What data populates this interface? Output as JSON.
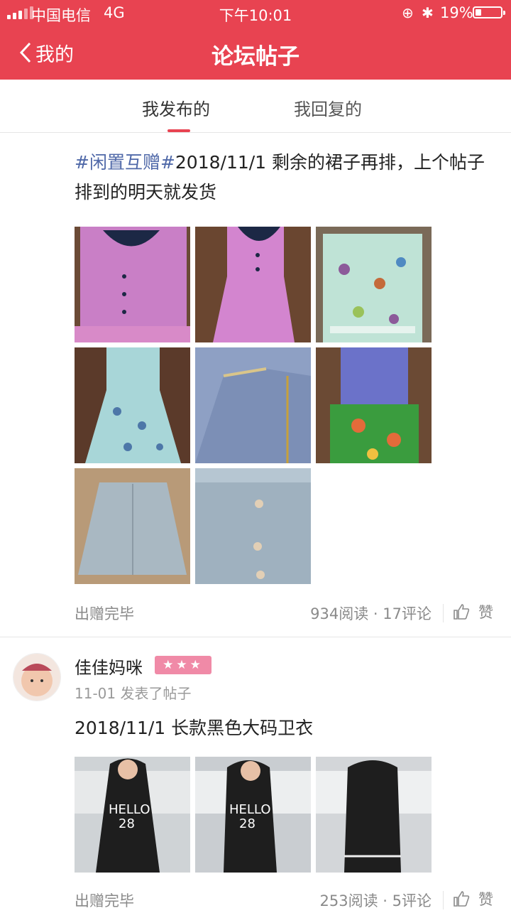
{
  "status_bar": {
    "carrier": "中国电信",
    "network": "4G",
    "time": "下午10:01",
    "battery": "19%"
  },
  "nav": {
    "back_label": "我的",
    "title": "论坛帖子"
  },
  "tabs": [
    {
      "label": "我发布的",
      "active": true
    },
    {
      "label": "我回复的",
      "active": false
    }
  ],
  "colors": {
    "brand": "#e84351",
    "tag": "#4f68a8",
    "muted": "#8a8a8a"
  },
  "posts": [
    {
      "tag": "#闲置互赠#",
      "text": "2018/11/1  剩余的裙子再排，上个帖子排到的明天就发货",
      "images": [
        "pink-blouse-photo",
        "pink-dress-photo",
        "floral-top-photo",
        "floral-dress-photo",
        "denim-dress-photo",
        "green-ruffle-dress-photo",
        "grey-skirt-photo",
        "grey-skirt-closeup-photo"
      ],
      "status": "出赠完毕",
      "stats": "934阅读 · 17评论",
      "like": "赞"
    },
    {
      "author": "佳佳妈咪",
      "badge": "★★★",
      "time": "11-01 发表了帖子",
      "text": "2018/11/1 长款黑色大码卫衣",
      "images": [
        "black-hoodie-front-photo",
        "black-hoodie-side-photo",
        "black-hoodie-back-photo"
      ],
      "status": "出赠完毕",
      "stats": "253阅读 · 5评论",
      "like": "赞"
    }
  ]
}
